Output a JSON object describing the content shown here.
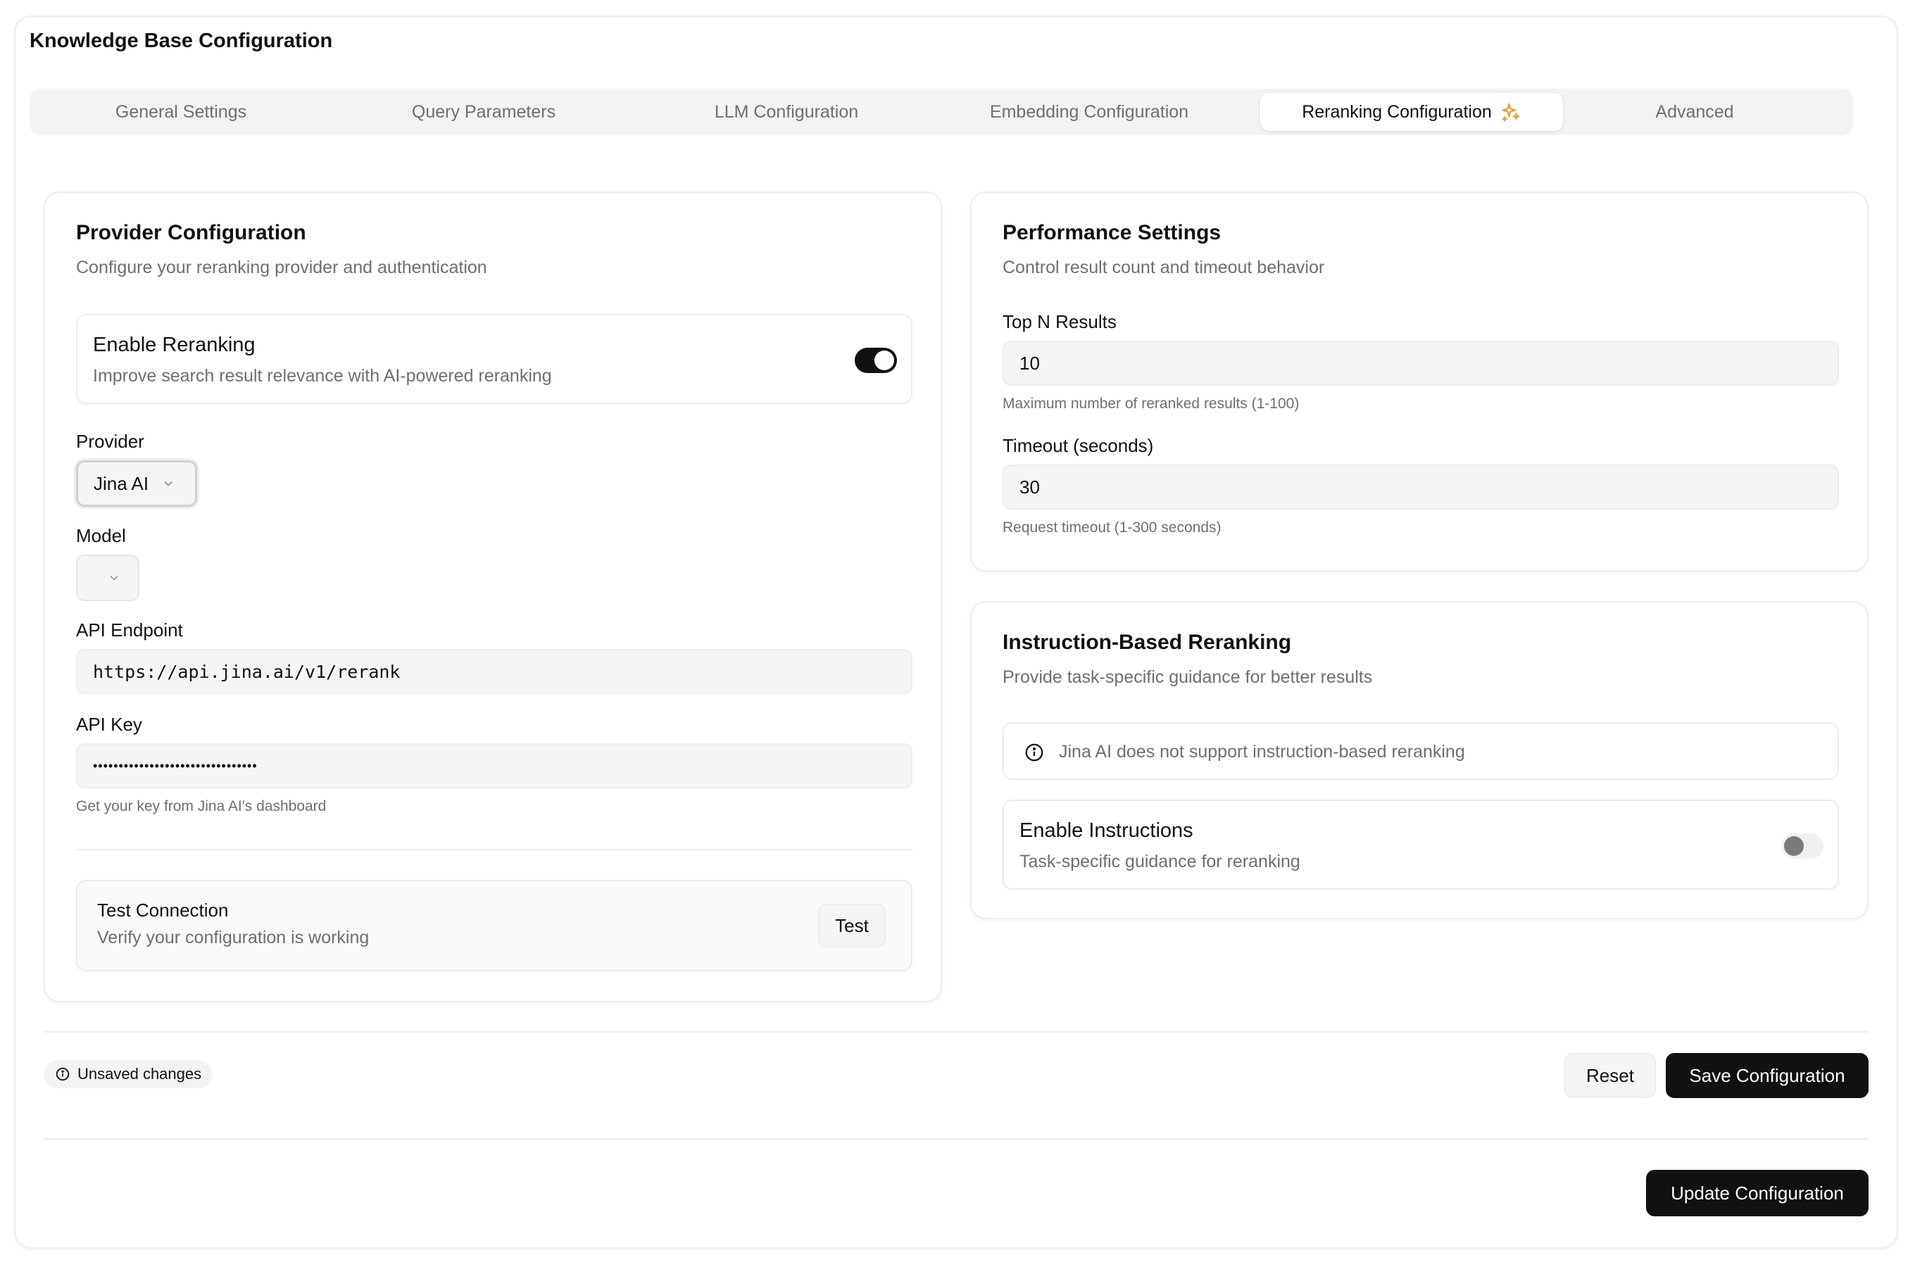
{
  "page": {
    "title": "Knowledge Base Configuration"
  },
  "tabs": [
    {
      "label": "General Settings"
    },
    {
      "label": "Query Parameters"
    },
    {
      "label": "LLM Configuration"
    },
    {
      "label": "Embedding Configuration"
    },
    {
      "label": "Reranking Configuration",
      "icon": "sparkles-icon",
      "active": true
    },
    {
      "label": "Advanced"
    }
  ],
  "provider_card": {
    "title": "Provider Configuration",
    "description": "Configure your reranking provider and authentication",
    "enable_reranking": {
      "title": "Enable Reranking",
      "description": "Improve search result relevance with AI-powered reranking",
      "enabled": true
    },
    "provider": {
      "label": "Provider",
      "value": "Jina AI"
    },
    "model": {
      "label": "Model",
      "value": ""
    },
    "api_endpoint": {
      "label": "API Endpoint",
      "value": "https://api.jina.ai/v1/rerank"
    },
    "api_key": {
      "label": "API Key",
      "value": "••••••••••••••••••••••••••••••••",
      "hint": "Get your key from Jina AI's dashboard"
    },
    "test_connection": {
      "title": "Test Connection",
      "description": "Verify your configuration is working",
      "button": "Test"
    }
  },
  "performance_card": {
    "title": "Performance Settings",
    "description": "Control result count and timeout behavior",
    "top_n": {
      "label": "Top N Results",
      "value": "10",
      "hint": "Maximum number of reranked results (1-100)"
    },
    "timeout": {
      "label": "Timeout (seconds)",
      "value": "30",
      "hint": "Request timeout (1-300 seconds)"
    }
  },
  "instruction_card": {
    "title": "Instruction-Based Reranking",
    "description": "Provide task-specific guidance for better results",
    "notice": "Jina AI does not support instruction-based reranking",
    "enable_instructions": {
      "title": "Enable Instructions",
      "description": "Task-specific guidance for reranking",
      "enabled": false
    }
  },
  "footer": {
    "unsaved": "Unsaved changes",
    "reset": "Reset",
    "save": "Save Configuration",
    "update": "Update Configuration"
  },
  "colors": {
    "primary": "#111111",
    "muted": "#6f6f6f",
    "border": "#ececec",
    "accent_icon": "#e8a23a"
  }
}
